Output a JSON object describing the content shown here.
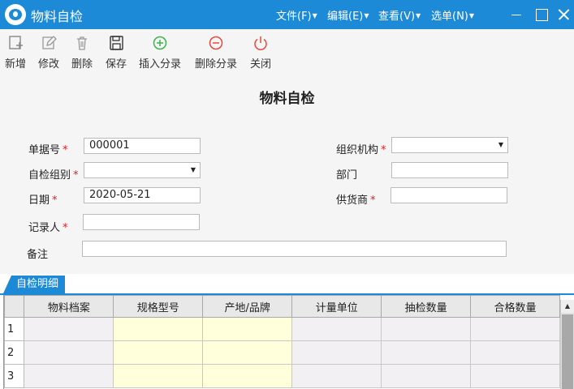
{
  "window": {
    "title": "物料自检",
    "menus": [
      "文件(F)",
      "编辑(E)",
      "查看(V)",
      "选单(N)"
    ]
  },
  "toolbar": {
    "new": "新增",
    "edit": "修改",
    "delete": "删除",
    "save": "保存",
    "insert_entry": "插入分录",
    "delete_entry": "删除分录",
    "close": "关闭"
  },
  "form": {
    "title": "物料自检",
    "doc_no_label": "单据号",
    "doc_no_value": "000001",
    "inspect_group_label": "自检组别",
    "inspect_group_value": "",
    "date_label": "日期",
    "date_value": "2020-05-21",
    "recorder_label": "记录人",
    "recorder_value": "",
    "remark_label": "备注",
    "remark_value": "",
    "org_label": "组织机构",
    "org_value": "",
    "dept_label": "部门",
    "dept_value": "",
    "supplier_label": "供货商",
    "supplier_value": "",
    "required_mark": "*"
  },
  "detail": {
    "tab_label": "自检明细",
    "columns": [
      "物料档案",
      "规格型号",
      "产地/品牌",
      "计量单位",
      "抽检数量",
      "合格数量"
    ],
    "rows": [
      "1",
      "2",
      "3"
    ]
  },
  "colors": {
    "accent": "#1d8ad8",
    "required": "#e02020",
    "editable_cell": "#ffffdc"
  }
}
